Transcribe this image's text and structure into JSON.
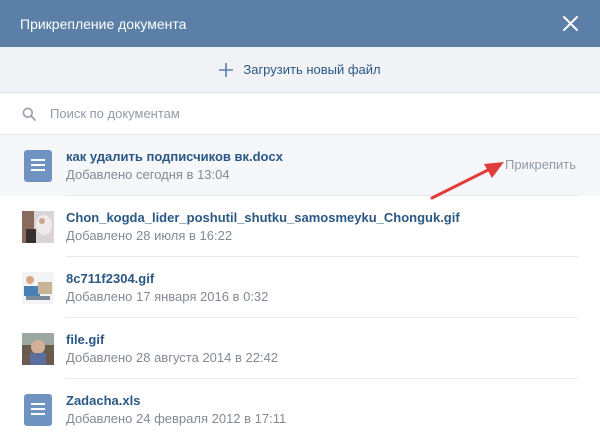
{
  "header": {
    "title": "Прикрепление документа"
  },
  "upload": {
    "label": "Загрузить новый файл"
  },
  "search": {
    "placeholder": "Поиск по документам"
  },
  "colors": {
    "header_bg": "#5b7fa6",
    "link": "#2a5885",
    "annotation_arrow": "#e03c3c"
  },
  "files": [
    {
      "name": "как удалить подписчиков вк.docx",
      "date": "Добавлено сегодня в 13:04",
      "type": "doc-icon"
    },
    {
      "name": "Chon_kogda_lider_poshutil_shutku_samosmeyku_Chonguk.gif",
      "date": "Добавлено 28 июля в 16:22",
      "type": "gif-thumbnail"
    },
    {
      "name": "8c711f2304.gif",
      "date": "Добавлено 17 января 2016 в 0:32",
      "type": "gif-thumbnail"
    },
    {
      "name": "file.gif",
      "date": "Добавлено 28 августа 2014 в 22:42",
      "type": "gif-thumbnail"
    },
    {
      "name": "Zadacha.xls",
      "date": "Добавлено 24 февраля 2012 в 17:11",
      "type": "doc-icon"
    }
  ],
  "attach_label": "Прикрепить"
}
